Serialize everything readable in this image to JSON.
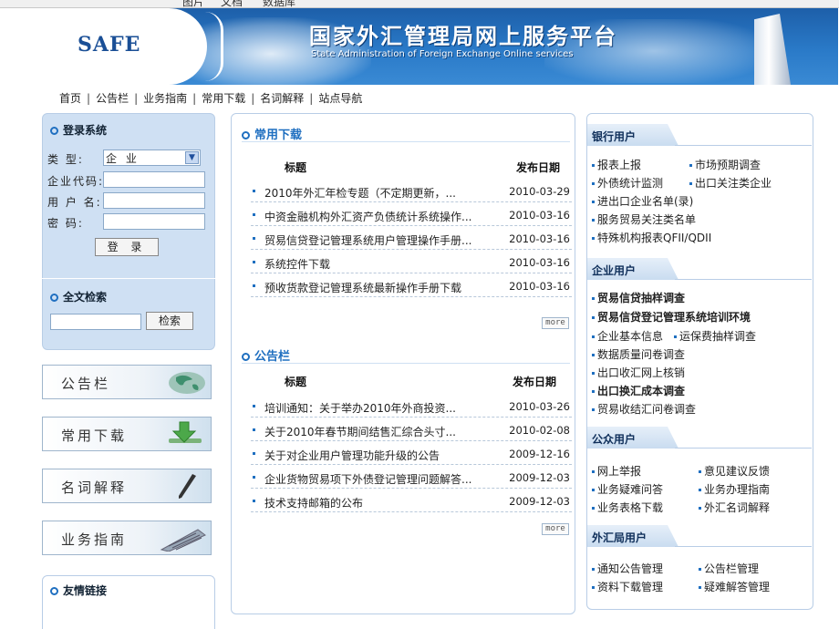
{
  "top_strip": {
    "a": "图片",
    "b": "文档",
    "c": "数据库"
  },
  "banner": {
    "logo": "SAFE",
    "title": "国家外汇管理局网上服务平台",
    "subtitle": "State Administration of Foreign Exchange Online services"
  },
  "nav": [
    "首页",
    "公告栏",
    "业务指南",
    "常用下载",
    "名词解释",
    "站点导航"
  ],
  "login": {
    "title": "登录系统",
    "type_label": "类  型:",
    "type_value": "企  业",
    "code_label": "企业代码:",
    "user_label": "用 户 名:",
    "pwd_label": "密  码:",
    "button": "登 录"
  },
  "fulltext": {
    "title": "全文检索",
    "button": "检索"
  },
  "image_buttons": [
    "公告栏",
    "常用下载",
    "名词解释",
    "业务指南"
  ],
  "friends": {
    "title": "友情链接"
  },
  "downloads": {
    "title": "常用下载",
    "col_title": "标题",
    "col_date": "发布日期",
    "rows": [
      {
        "t": "2010年外汇年检专题（不定期更新，...",
        "d": "2010-03-29"
      },
      {
        "t": "中资金融机构外汇资产负债统计系统操作...",
        "d": "2010-03-16"
      },
      {
        "t": "贸易信贷登记管理系统用户管理操作手册...",
        "d": "2010-03-16"
      },
      {
        "t": "系统控件下载",
        "d": "2010-03-16"
      },
      {
        "t": "预收货款登记管理系统最新操作手册下载",
        "d": "2010-03-16"
      }
    ],
    "more": "more"
  },
  "notices": {
    "title": "公告栏",
    "col_title": "标题",
    "col_date": "发布日期",
    "rows": [
      {
        "t": "培训通知：关于举办2010年外商投资...",
        "d": "2010-03-26"
      },
      {
        "t": "关于2010年春节期间结售汇综合头寸...",
        "d": "2010-02-08"
      },
      {
        "t": "关于对企业用户管理功能升级的公告",
        "d": "2009-12-16"
      },
      {
        "t": "企业货物贸易项下外债登记管理问题解答...",
        "d": "2009-12-03"
      },
      {
        "t": "技术支持邮箱的公布",
        "d": "2009-12-03"
      }
    ],
    "more": "more"
  },
  "bank_users": {
    "title": "银行用户",
    "links": [
      "报表上报",
      "市场预期调查",
      "外债统计监测",
      "出口关注类企业",
      "进出口企业名单(录)",
      "服务贸易关注类名单",
      "特殊机构报表QFII/QDII"
    ]
  },
  "enterprise_users": {
    "title": "企业用户",
    "links": [
      "贸易信贷抽样调查",
      "贸易信贷登记管理系统培训环境",
      "企业基本信息",
      "运保费抽样调查",
      "数据质量问卷调查",
      "出口收汇网上核销",
      "出口换汇成本调查",
      "贸易收结汇问卷调查"
    ]
  },
  "public_users": {
    "title": "公众用户",
    "links": [
      "网上举报",
      "意见建议反馈",
      "业务疑难问答",
      "业务办理指南",
      "业务表格下载",
      "外汇名词解释"
    ]
  },
  "safe_users": {
    "title": "外汇局用户",
    "links": [
      "通知公告管理",
      "公告栏管理",
      "资料下载管理",
      "疑难解答管理"
    ]
  },
  "colors": {
    "accent": "#1f6fc0",
    "panel": "#cfe0f3",
    "banner": "#2a7ac8"
  }
}
